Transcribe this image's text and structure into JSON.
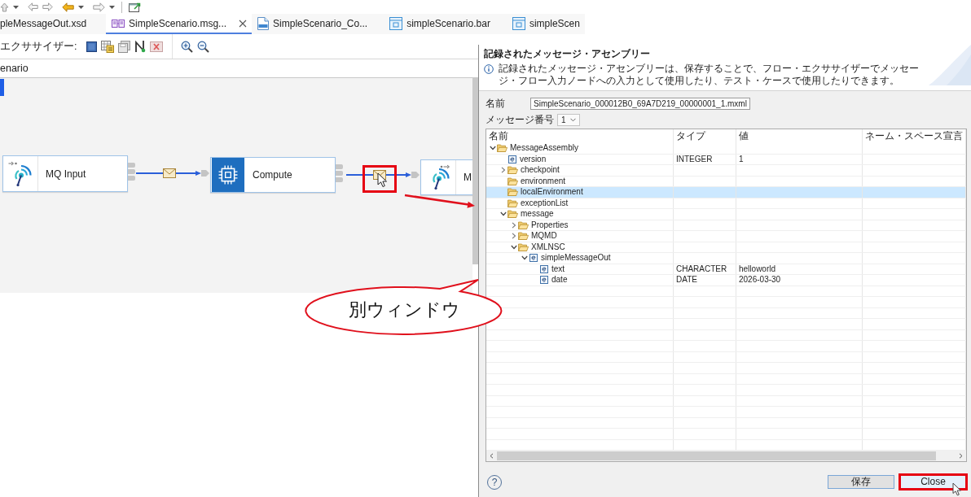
{
  "editor_tabs": [
    {
      "label": "pleMessageOut.xsd",
      "selected": false
    },
    {
      "label": "SimpleScenario.msg...",
      "kind": "msgflow",
      "selected": true
    },
    {
      "label": "SimpleScenario_Co...",
      "kind": "esql",
      "selected": false
    },
    {
      "label": "simpleScenario.bar",
      "kind": "bar",
      "selected": false
    },
    {
      "label": "simpleScen",
      "kind": "bar",
      "selected": false
    }
  ],
  "exerciser_toolbar": {
    "label": "エクササイザー:"
  },
  "breadcrumb": "enario",
  "flow": {
    "nodes": [
      {
        "label": "MQ Input",
        "kind": "mq-input"
      },
      {
        "label": "Compute",
        "kind": "compute"
      },
      {
        "label": "M",
        "kind": "mq-output"
      }
    ],
    "connections": [
      {
        "highlighted": false
      },
      {
        "highlighted": true
      }
    ]
  },
  "callout": {
    "text": "別ウィンドウ"
  },
  "dialog": {
    "title": "記録されたメッセージ・アセンブリー",
    "info": "記録されたメッセージ・アセンブリーは、保存することで、フロー・エクササイザーでメッセージ・フロー入力ノードへの入力として使用したり、テスト・ケースで使用したりできます。",
    "name_label": "名前",
    "name_value": "SimpleScenario_000012B0_69A7D219_00000001_1.mxml",
    "message_number_label": "メッセージ番号",
    "message_number": "1",
    "tree": {
      "columns": [
        "名前",
        "タイプ",
        "値",
        "ネーム・スペース宣言"
      ],
      "items": [
        {
          "name": "MessageAssembly",
          "kind": "folder",
          "expanded": true,
          "selected": false,
          "children": [
            {
              "name": "version",
              "kind": "element",
              "type": "INTEGER",
              "value": "1",
              "selected": false
            },
            {
              "name": "checkpoint",
              "kind": "folder",
              "expanded": false,
              "selected": false
            },
            {
              "name": "environment",
              "kind": "folder",
              "selected": false
            },
            {
              "name": "localEnvironment",
              "kind": "folder",
              "selected": true
            },
            {
              "name": "exceptionList",
              "kind": "folder",
              "selected": false
            },
            {
              "name": "message",
              "kind": "folder",
              "expanded": true,
              "selected": false,
              "children": [
                {
                  "name": "Properties",
                  "kind": "folder",
                  "expanded": false,
                  "selected": false
                },
                {
                  "name": "MQMD",
                  "kind": "folder",
                  "expanded": false,
                  "selected": false
                },
                {
                  "name": "XMLNSC",
                  "kind": "folder",
                  "expanded": true,
                  "selected": false,
                  "children": [
                    {
                      "name": "simpleMessageOut",
                      "kind": "element",
                      "expanded": true,
                      "selected": false,
                      "children": [
                        {
                          "name": "text",
                          "kind": "element",
                          "type": "CHARACTER",
                          "value": "helloworld",
                          "selected": false
                        },
                        {
                          "name": "date",
                          "kind": "element",
                          "type": "DATE",
                          "value": "2026-03-30",
                          "selected": false
                        }
                      ]
                    }
                  ]
                }
              ]
            }
          ]
        }
      ]
    },
    "help": "?",
    "buttons": [
      {
        "label": "保存",
        "highlighted": false
      },
      {
        "label": "Close",
        "highlighted": true
      }
    ]
  }
}
